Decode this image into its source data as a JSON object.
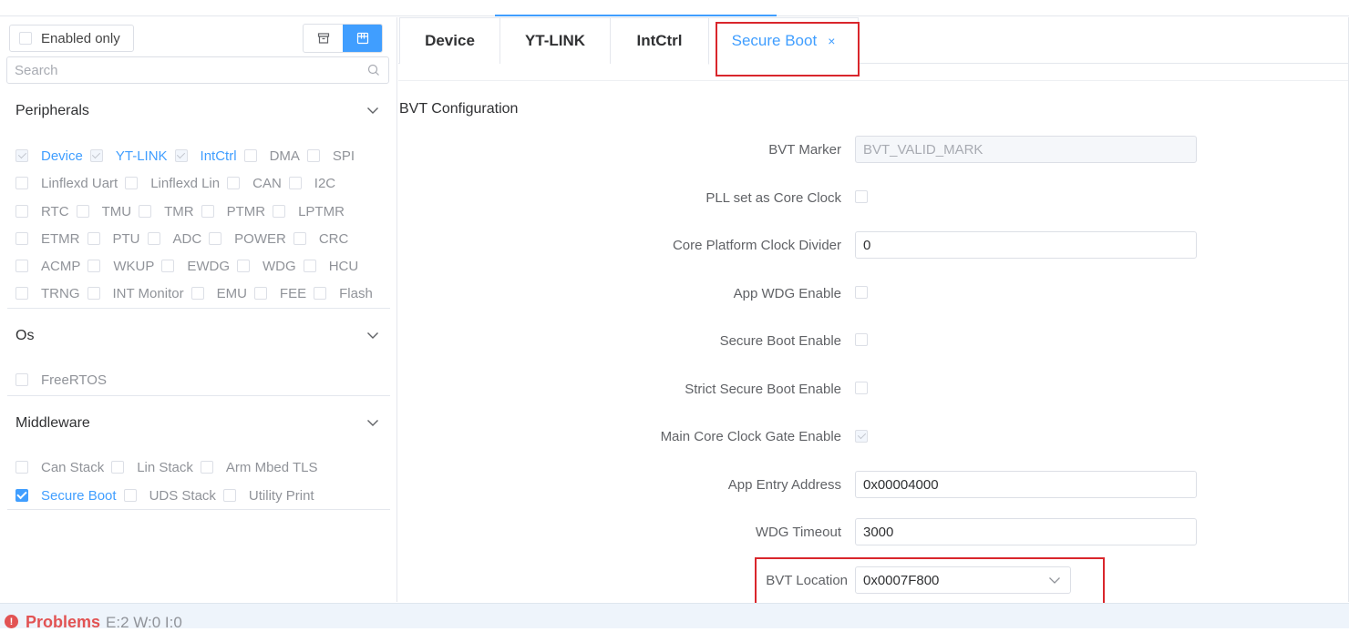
{
  "sidebar": {
    "enabled_only_label": "Enabled only",
    "search_placeholder": "Search",
    "sections": [
      {
        "title": "Peripherals",
        "rows": [
          [
            {
              "label": "Device",
              "state": "checked-disabled"
            },
            {
              "label": "YT-LINK",
              "state": "checked-disabled"
            },
            {
              "label": "IntCtrl",
              "state": "checked-disabled"
            },
            {
              "label": "DMA",
              "state": "unchecked"
            },
            {
              "label": "SPI",
              "state": "unchecked"
            }
          ],
          [
            {
              "label": "Linflexd Uart",
              "state": "unchecked"
            },
            {
              "label": "Linflexd Lin",
              "state": "unchecked"
            },
            {
              "label": "CAN",
              "state": "unchecked"
            },
            {
              "label": "I2C",
              "state": "unchecked"
            }
          ],
          [
            {
              "label": "RTC",
              "state": "unchecked"
            },
            {
              "label": "TMU",
              "state": "unchecked"
            },
            {
              "label": "TMR",
              "state": "unchecked"
            },
            {
              "label": "PTMR",
              "state": "unchecked"
            },
            {
              "label": "LPTMR",
              "state": "unchecked"
            }
          ],
          [
            {
              "label": "ETMR",
              "state": "unchecked"
            },
            {
              "label": "PTU",
              "state": "unchecked"
            },
            {
              "label": "ADC",
              "state": "unchecked"
            },
            {
              "label": "POWER",
              "state": "unchecked"
            },
            {
              "label": "CRC",
              "state": "unchecked"
            }
          ],
          [
            {
              "label": "ACMP",
              "state": "unchecked"
            },
            {
              "label": "WKUP",
              "state": "unchecked"
            },
            {
              "label": "EWDG",
              "state": "unchecked"
            },
            {
              "label": "WDG",
              "state": "unchecked"
            },
            {
              "label": "HCU",
              "state": "unchecked"
            }
          ],
          [
            {
              "label": "TRNG",
              "state": "unchecked"
            },
            {
              "label": "INT Monitor",
              "state": "unchecked"
            },
            {
              "label": "EMU",
              "state": "unchecked"
            },
            {
              "label": "FEE",
              "state": "unchecked"
            },
            {
              "label": "Flash",
              "state": "unchecked"
            }
          ]
        ]
      },
      {
        "title": "Os",
        "rows": [
          [
            {
              "label": "FreeRTOS",
              "state": "unchecked"
            }
          ]
        ]
      },
      {
        "title": "Middleware",
        "rows": [
          [
            {
              "label": "Can Stack",
              "state": "unchecked"
            },
            {
              "label": "Lin Stack",
              "state": "unchecked"
            },
            {
              "label": "Arm Mbed TLS",
              "state": "unchecked"
            }
          ],
          [
            {
              "label": "Secure Boot",
              "state": "checked"
            },
            {
              "label": "UDS Stack",
              "state": "unchecked"
            },
            {
              "label": "Utility Print",
              "state": "unchecked"
            }
          ]
        ]
      }
    ]
  },
  "tabs": [
    {
      "label": "Device"
    },
    {
      "label": "YT-LINK"
    },
    {
      "label": "IntCtrl"
    },
    {
      "label": "Secure Boot",
      "active": true,
      "close": "×"
    }
  ],
  "config": {
    "title": "BVT Configuration",
    "bvt_marker": {
      "label": "BVT Marker",
      "value": "BVT_VALID_MARK"
    },
    "pll_core_clock": {
      "label": "PLL set as Core Clock",
      "checked": false
    },
    "core_platform_clock_divider": {
      "label": "Core Platform Clock Divider",
      "value": "0"
    },
    "app_wdg_enable": {
      "label": "App WDG Enable",
      "checked": false
    },
    "secure_boot_enable": {
      "label": "Secure Boot Enable",
      "checked": false
    },
    "strict_secure_boot_enable": {
      "label": "Strict Secure Boot Enable",
      "checked": false
    },
    "main_core_clock_gate_enable": {
      "label": "Main Core Clock Gate Enable",
      "checked": true
    },
    "app_entry_address": {
      "label": "App Entry Address",
      "value": "0x00004000"
    },
    "wdg_timeout": {
      "label": "WDG Timeout",
      "value": "3000"
    },
    "bvt_location": {
      "label": "BVT Location",
      "value": "0x0007F800"
    }
  },
  "problems": {
    "title": "Problems",
    "counts": "E:2 W:0 I:0",
    "icon": "!"
  },
  "colors": {
    "accent": "#409eff",
    "highlight_box": "#d9262c",
    "error": "#e25353"
  }
}
